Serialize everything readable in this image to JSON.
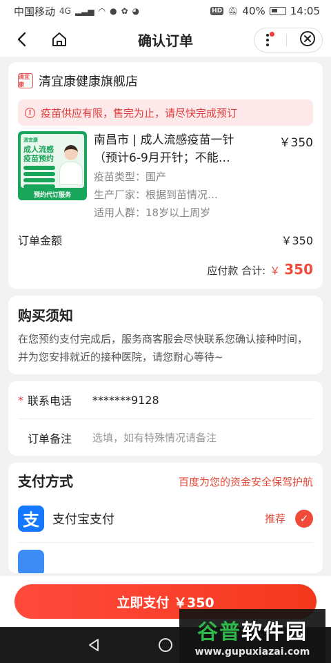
{
  "status_bar": {
    "carrier": "中国移动",
    "network": "4G",
    "hd_badge": "HD",
    "battery": "40%",
    "time": "14:05"
  },
  "nav": {
    "title": "确认订单"
  },
  "store": {
    "name": "清宜康健康旗舰店",
    "logo_text": "清宜康"
  },
  "notice": {
    "icon": "!",
    "text": "疫苗供应有限，售完为止，请尽快完成预订"
  },
  "product": {
    "title": "南昌市 | 成人流感疫苗一针（预计6-9月开针；不能…",
    "price": "￥350",
    "image": {
      "brand": "清宜康",
      "headline": "成人流感疫苗预约",
      "footer": "预约代订服务"
    },
    "attributes": [
      "疫苗类型：国产",
      "生产厂家：根据到苗情况…",
      "适用人群：18岁以上周岁"
    ]
  },
  "order": {
    "amount_label": "订单金额",
    "amount_value": "￥350",
    "payable_label": "应付款 合计:",
    "payable_currency": "￥",
    "payable_value": "350"
  },
  "purchase_notes": {
    "title": "购买须知",
    "text": "在您预约支付完成后，服务商客服会尽快联系您确认接种时间，并为您安排就近的接种医院，请您耐心等待~"
  },
  "form": {
    "phone_required_mark": "*",
    "phone_label": "联系电话",
    "phone_value": "*******9128",
    "remark_label": "订单备注",
    "remark_placeholder": "选填，如有特殊情况请备注"
  },
  "payment": {
    "title": "支付方式",
    "secure_text": "百度为您的资金安全保驾护航",
    "method_name": "支付宝支付",
    "method_icon": "支",
    "recommend": "推荐",
    "check": "✓"
  },
  "bottom": {
    "pay_button": "立即支付 ￥350"
  },
  "watermark": {
    "cn_part1": "谷普",
    "cn_part2": "软件园",
    "en": "www.gupuxiazai.com"
  },
  "colors": {
    "accent": "#f04a3a",
    "alipay": "#1677ff",
    "product_green": "#19a65a"
  }
}
